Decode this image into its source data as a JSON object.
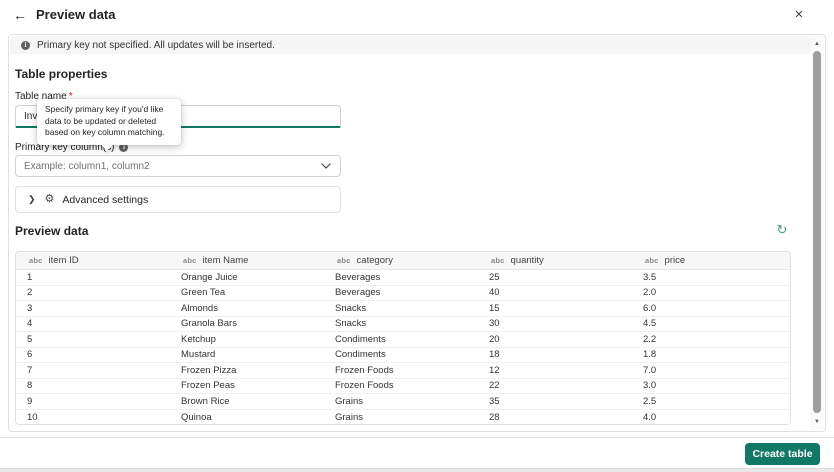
{
  "header": {
    "title": "Preview data",
    "back_icon": "back-arrow",
    "close_icon": "close-x"
  },
  "banner": {
    "text": "Primary key not specified. All updates will be inserted.",
    "icon": "info-filled"
  },
  "table_properties": {
    "heading": "Table properties",
    "table_name_label": "Table name",
    "required_marker": "*",
    "table_name_value": "Inv",
    "primary_key_label": "Primary key column(s)",
    "primary_key_placeholder": "Example: column1, column2",
    "advanced_settings_label": "Advanced settings"
  },
  "tooltip": {
    "text": "Specify primary key if you'd like data to be updated or deleted based on key column matching."
  },
  "preview": {
    "heading": "Preview data",
    "columns": [
      {
        "type": "abc",
        "label": "item ID"
      },
      {
        "type": "abc",
        "label": "item Name"
      },
      {
        "type": "abc",
        "label": "category"
      },
      {
        "type": "abc",
        "label": "quantity"
      },
      {
        "type": "abc",
        "label": "price"
      }
    ],
    "rows": [
      [
        "1",
        "Orange Juice",
        "Beverages",
        "25",
        "3.5"
      ],
      [
        "2",
        "Green Tea",
        "Beverages",
        "40",
        "2.0"
      ],
      [
        "3",
        "Almonds",
        "Snacks",
        "15",
        "6.0"
      ],
      [
        "4",
        "Granola Bars",
        "Snacks",
        "30",
        "4.5"
      ],
      [
        "5",
        "Ketchup",
        "Condiments",
        "20",
        "2.2"
      ],
      [
        "6",
        "Mustard",
        "Condiments",
        "18",
        "1.8"
      ],
      [
        "7",
        "Frozen Pizza",
        "Frozen Foods",
        "12",
        "7.0"
      ],
      [
        "8",
        "Frozen Peas",
        "Frozen Foods",
        "22",
        "3.0"
      ],
      [
        "9",
        "Brown Rice",
        "Grains",
        "35",
        "2.5"
      ],
      [
        "10",
        "Quinoa",
        "Grains",
        "28",
        "4.0"
      ]
    ]
  },
  "footer": {
    "create_button_label": "Create table"
  },
  "glyphs": {
    "back": "←",
    "close": "✕",
    "info": "i",
    "adv_chevron": "❯",
    "gear": "⚙",
    "refresh": "↻",
    "sb_up": "▲",
    "sb_down": "▼"
  },
  "colors": {
    "accent_teal": "#117865",
    "banner_bg": "#f5f5f5",
    "border": "#e0e0e0",
    "required_red": "#c50f1f",
    "placeholder": "#707070"
  }
}
